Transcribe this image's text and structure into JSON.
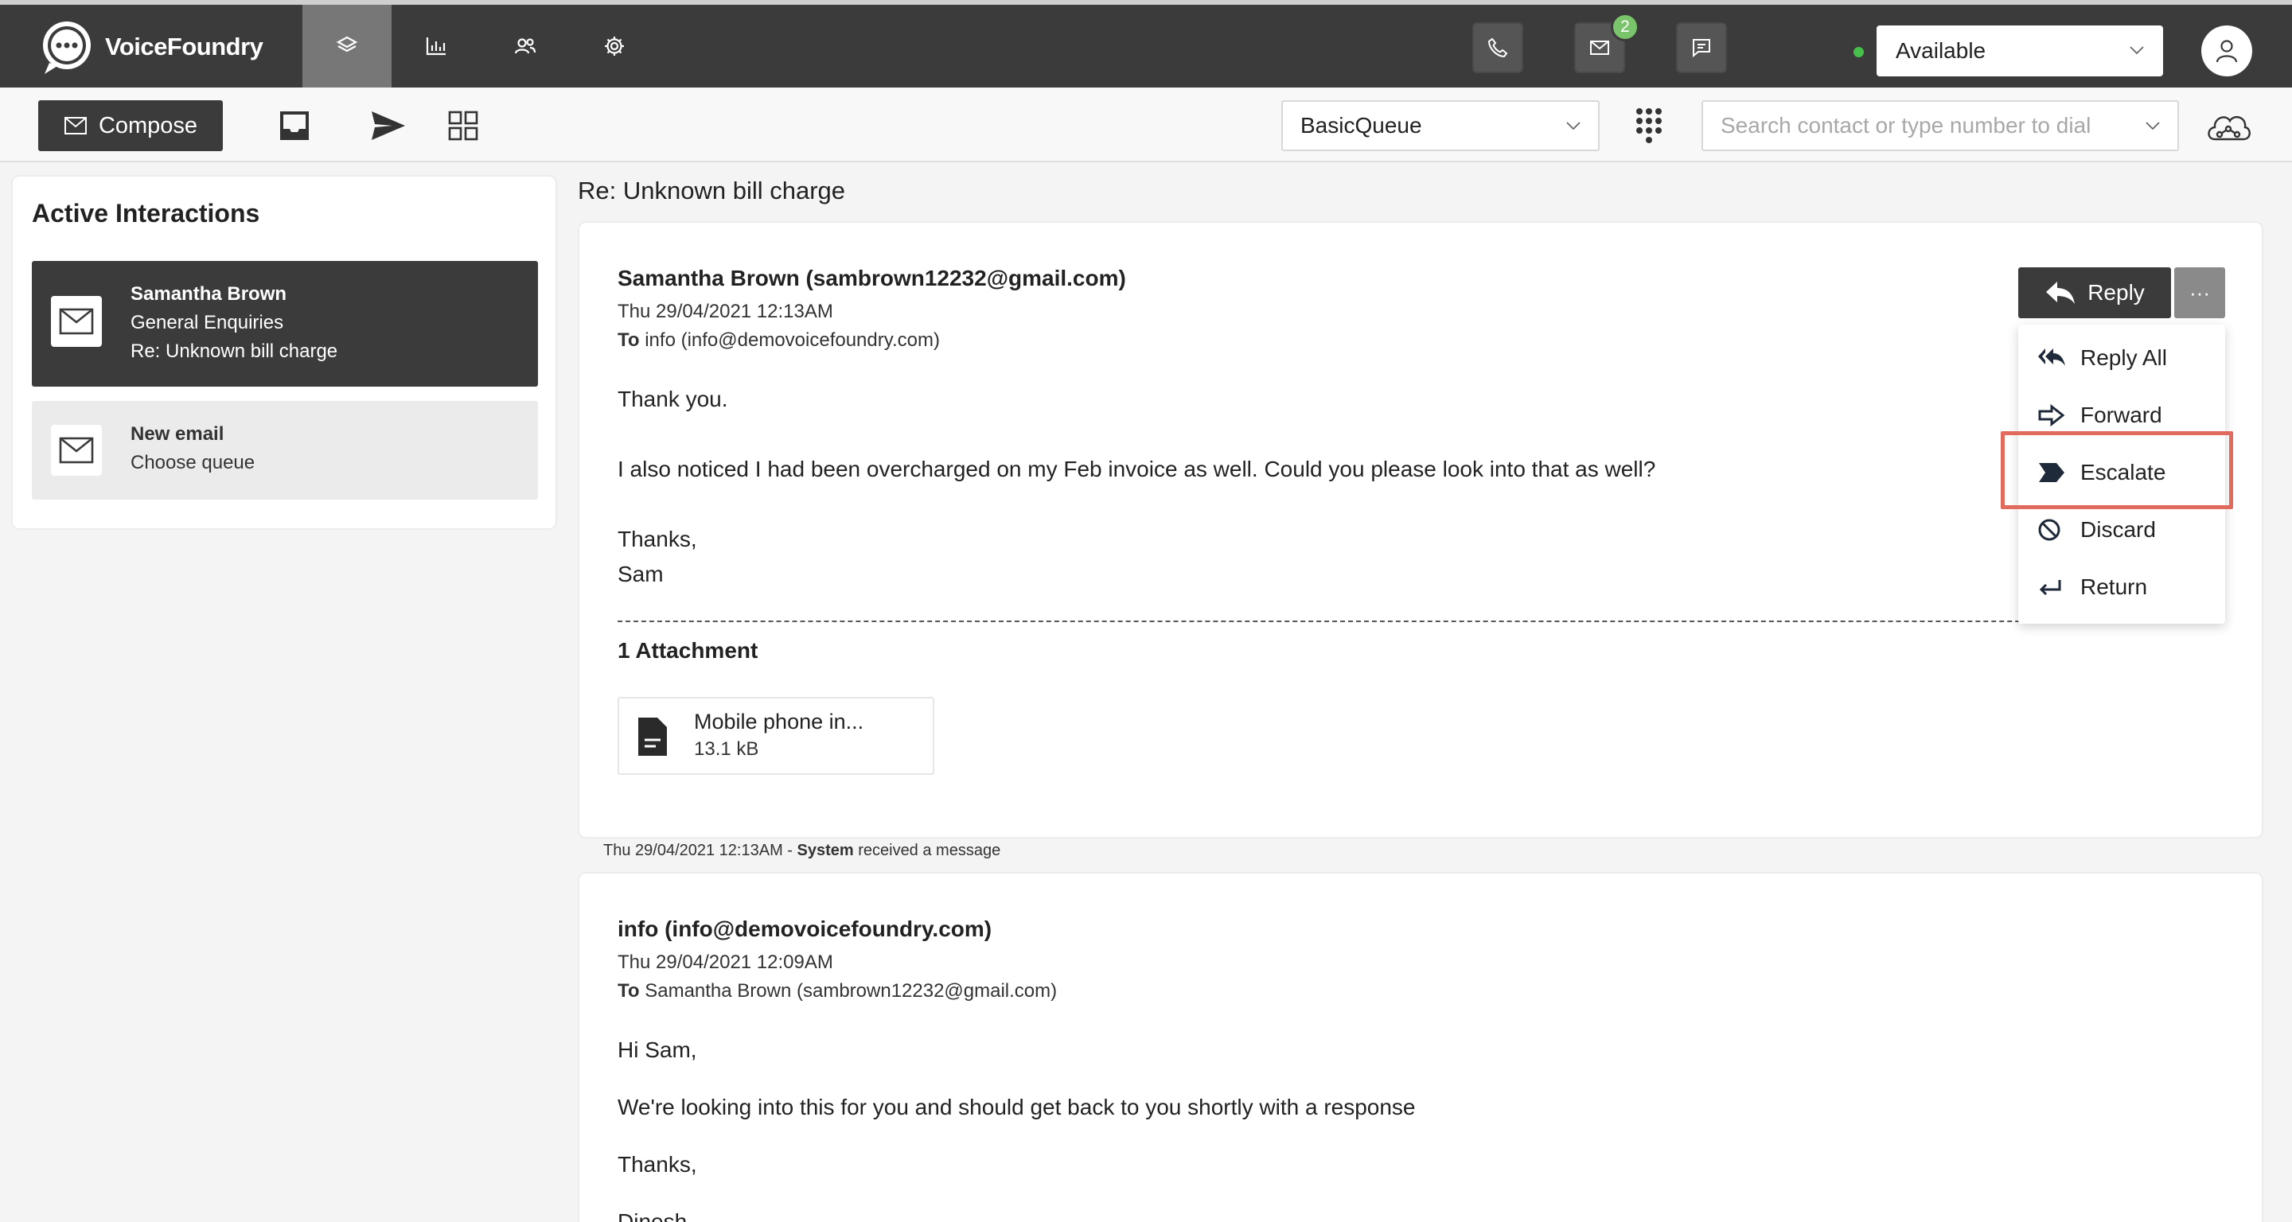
{
  "app": {
    "brand": "VoiceFoundry",
    "nav": [
      "layers-icon",
      "bar-chart-icon",
      "users-icon",
      "gear-icon"
    ],
    "email_badge": "2",
    "status": "Available",
    "status_color": "#46c04b"
  },
  "toolbar": {
    "compose_label": "Compose",
    "queue": "BasicQueue",
    "search_placeholder": "Search contact or type number to dial"
  },
  "sidebar": {
    "title": "Active Interactions",
    "items": [
      {
        "name": "Samantha Brown",
        "queue": "General Enquiries",
        "subject": "Re: Unknown bill charge"
      },
      {
        "name": "New email",
        "queue": "Choose queue"
      }
    ]
  },
  "conversation": {
    "title": "Re: Unknown bill charge",
    "messages": [
      {
        "from": "Samantha Brown (sambrown12232@gmail.com)",
        "date": "Thu 29/04/2021 12:13AM",
        "to_label": "To",
        "to": "info (info@demovoicefoundry.com)",
        "lines": [
          "Thank you.",
          "I also noticed I had been overcharged on my Feb invoice as well. Could you please look into that as well?",
          "Thanks,",
          "Sam"
        ],
        "attachments_title": "1 Attachment",
        "attachment": {
          "name": "Mobile phone in...",
          "size": "13.1 kB"
        }
      },
      {
        "from": "info (info@demovoicefoundry.com)",
        "date": "Thu 29/04/2021 12:09AM",
        "to_label": "To",
        "to": "Samantha Brown (sambrown12232@gmail.com)",
        "lines": [
          "Hi Sam,",
          "We're looking into this for you and should get back to you shortly with a response",
          "Thanks,",
          "Dinesh"
        ]
      }
    ],
    "system_event": {
      "time": "Thu 29/04/2021 12:13AM - ",
      "actor": "System",
      "action": " received a message"
    }
  },
  "actions": {
    "reply_label": "Reply",
    "more_label": "···",
    "menu": [
      "Reply All",
      "Forward",
      "Escalate",
      "Discard",
      "Return"
    ],
    "highlight_color": "#e06a5c"
  }
}
